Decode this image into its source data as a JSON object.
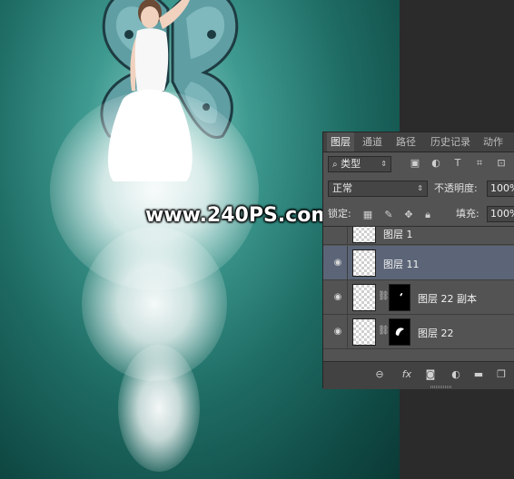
{
  "watermark": "www.240PS.com",
  "colors": {
    "accent_selected_layer": "#5b6577",
    "canvas_teal": "#1e6c64",
    "panel_bg": "#535353"
  },
  "layers_panel": {
    "tabs": [
      {
        "label": "图层",
        "active": true
      },
      {
        "label": "通道",
        "active": false
      },
      {
        "label": "路径",
        "active": false
      },
      {
        "label": "历史记录",
        "active": false
      },
      {
        "label": "动作",
        "active": false
      }
    ],
    "filter": {
      "kind_label": "类型",
      "filter_icons": [
        "image-filter-icon",
        "adjustment-filter-icon",
        "type-filter-icon",
        "shape-filter-icon",
        "smart-object-filter-icon"
      ]
    },
    "blend_mode": "正常",
    "opacity_label": "不透明度:",
    "opacity_value": "100%",
    "lock_label": "锁定:",
    "lock_icons": [
      "lock-transparent-icon",
      "lock-paint-icon",
      "lock-position-icon",
      "lock-all-icon"
    ],
    "fill_label": "填充:",
    "fill_value": "100%",
    "layers": [
      {
        "name": "图层 1",
        "visible": false,
        "selected": false,
        "has_mask": false
      },
      {
        "name": "图层 11",
        "visible": true,
        "selected": true,
        "has_mask": false
      },
      {
        "name": "图层 22 副本",
        "visible": true,
        "selected": false,
        "has_mask": true
      },
      {
        "name": "图层 22",
        "visible": true,
        "selected": false,
        "has_mask": true
      }
    ],
    "footer_icons": [
      "link-layers-icon",
      "fx-icon",
      "add-mask-icon",
      "adjustment-layer-icon",
      "new-group-icon",
      "new-layer-icon",
      "delete-layer-icon"
    ],
    "fx_label": "fx"
  }
}
